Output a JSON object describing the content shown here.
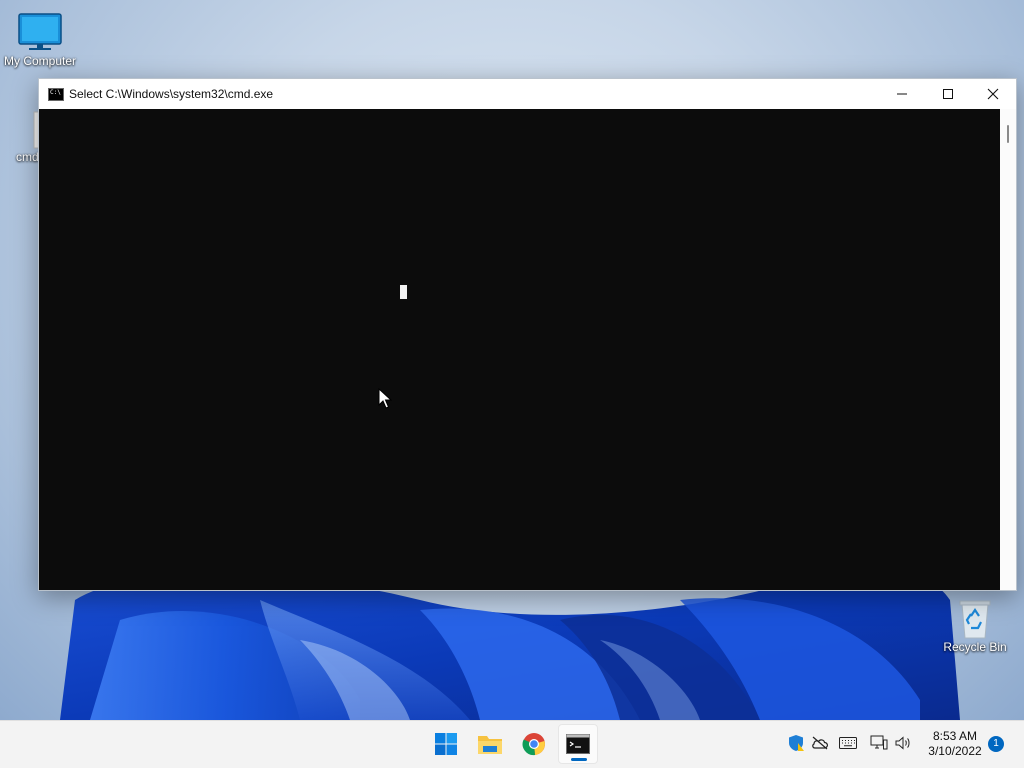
{
  "desktop": {
    "icons": [
      {
        "label": "My Computer",
        "icon": "monitor-icon"
      },
      {
        "label": "cmd",
        "icon": "settings-shortcut-icon"
      },
      {
        "label": "Recycle Bin",
        "icon": "recycle-bin-icon"
      }
    ]
  },
  "window": {
    "title": "Select C:\\Windows\\system32\\cmd.exe",
    "icon_text": "C:\\",
    "buttons": [
      "minimize-icon",
      "maximize-icon",
      "close-icon"
    ],
    "console_background": "#0c0c0c",
    "console_text_color": "#f2f2f2"
  },
  "taskbar": {
    "apps": [
      "windows-start-icon",
      "file-explorer-icon",
      "chrome-icon",
      "command-prompt-icon"
    ],
    "active_app": "command-prompt-icon",
    "accent_color": "#0067c0",
    "tray": [
      "windows-security-icon",
      "onedrive-offline-icon",
      "touch-keyboard-icon",
      "network-icon",
      "volume-icon"
    ],
    "clock": {
      "time": "8:53 AM",
      "date": "3/10/2022"
    },
    "notification_count": "1"
  }
}
